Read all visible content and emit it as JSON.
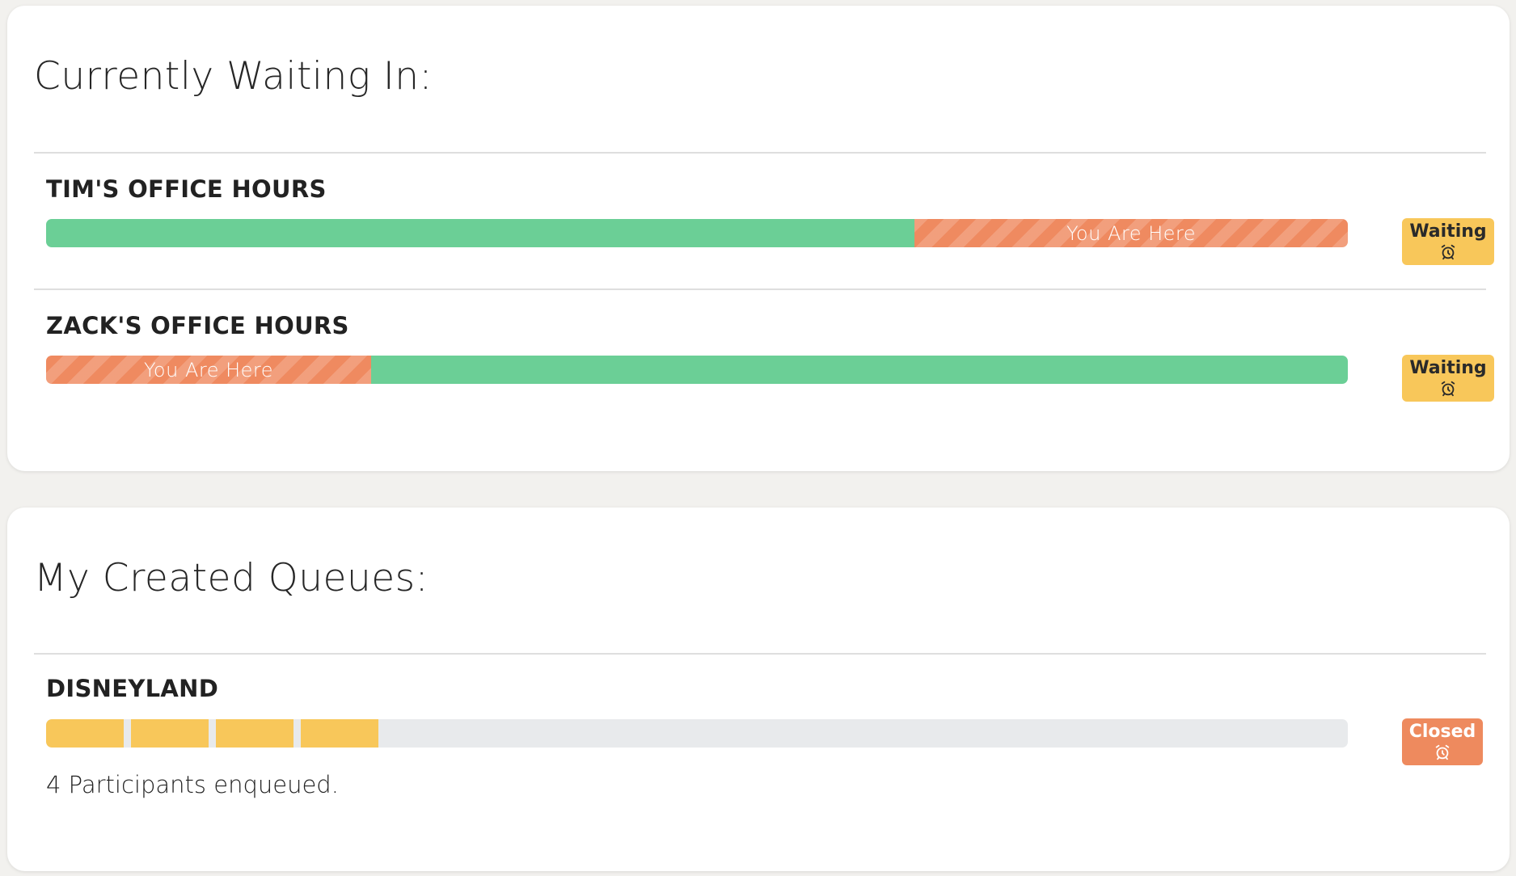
{
  "waiting_section": {
    "title": "Currently Waiting In:",
    "queues": [
      {
        "name": "TIM'S OFFICE HOURS",
        "position_marker_label": "You Are Here",
        "progress_ahead_fraction": 0.667,
        "status_label": "Waiting",
        "status_icon": "alarm-clock-icon"
      },
      {
        "name": "ZACK'S OFFICE HOURS",
        "position_marker_label": "You Are Here",
        "progress_ahead_fraction": 0.0,
        "status_label": "Waiting",
        "status_icon": "alarm-clock-icon"
      }
    ]
  },
  "created_section": {
    "title": "My Created Queues:",
    "queues": [
      {
        "name": "DISNEYLAND",
        "participant_count": 4,
        "participants_text": "4 Participants enqueued.",
        "status_label": "Closed",
        "status_icon": "alarm-clock-icon"
      }
    ]
  },
  "colors": {
    "progress_green": "#6bcf96",
    "you_are_here_orange": "#ef8a60",
    "waiting_badge_yellow": "#f8c75a",
    "closed_badge_orange": "#ee8a5e",
    "participant_yellow": "#f8c75a",
    "empty_track_gray": "#e8eaec"
  }
}
